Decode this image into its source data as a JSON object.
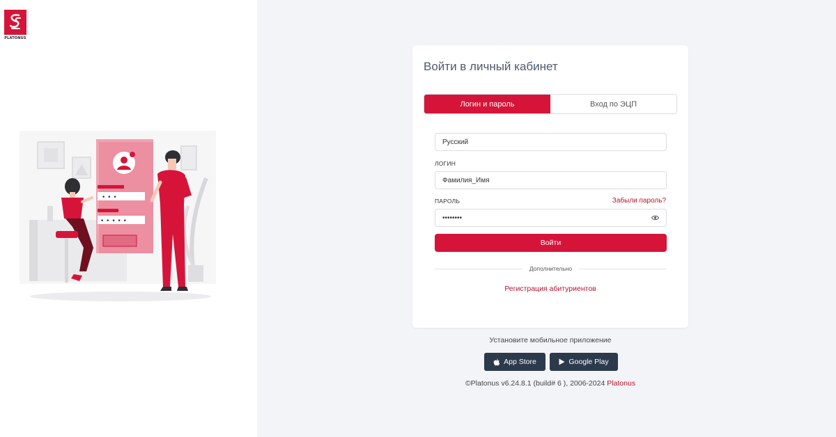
{
  "brand": {
    "logo_text": "PLATONUS",
    "accent_color": "#d6143a"
  },
  "login_card": {
    "title": "Войти в личный кабинет",
    "tabs": [
      {
        "label": "Логин и пароль",
        "active": true
      },
      {
        "label": "Вход по ЭЦП",
        "active": false
      }
    ],
    "language_select": {
      "value": "Русский"
    },
    "login_field": {
      "label": "ЛОГИН",
      "value": "Фамилия_Имя"
    },
    "password_field": {
      "label": "ПАРОЛЬ",
      "value": "••••••••",
      "forgot_label": "Забыли пароль?"
    },
    "submit_label": "Войти",
    "divider_text": "Дополнительно",
    "register_link": "Регистрация абитуриентов"
  },
  "mobile": {
    "prompt": "Установите мобильное приложение",
    "app_store_label": "App Store",
    "google_play_label": "Google Play"
  },
  "footer": {
    "copyright": "©Platonus v6.24.8.1 (build# 6 ), 2006-2024 ",
    "brand_link": "Platonus"
  }
}
